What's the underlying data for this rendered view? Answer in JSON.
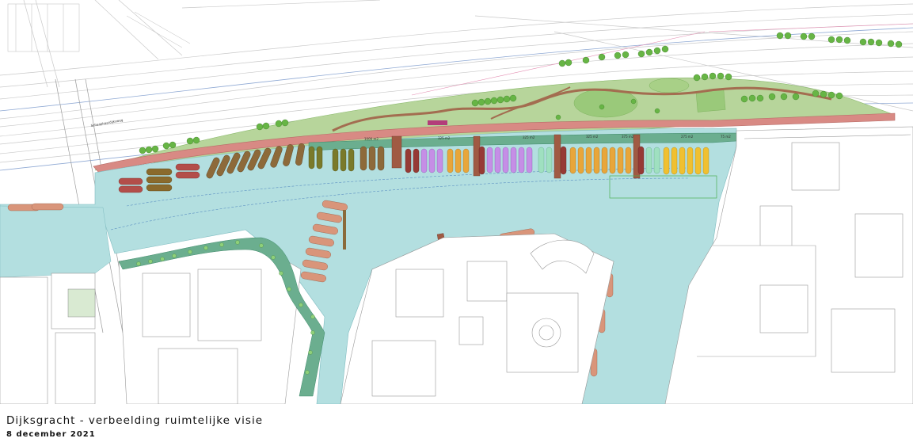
{
  "caption": {
    "title": "Dijksgracht - verbeelding ruimtelijke visie",
    "date": "8 december 2021"
  },
  "plan": {
    "area_labels": [
      "1000 m2",
      "325 m2",
      "325 m2",
      "325 m2",
      "375 m2",
      "275 m2",
      "75 m2"
    ],
    "colors": {
      "water": "#b3dfe0",
      "park": "#a9cf8a",
      "promenade": "#d88a84",
      "quay": "#6bae8f",
      "trees": "#67b545"
    }
  }
}
